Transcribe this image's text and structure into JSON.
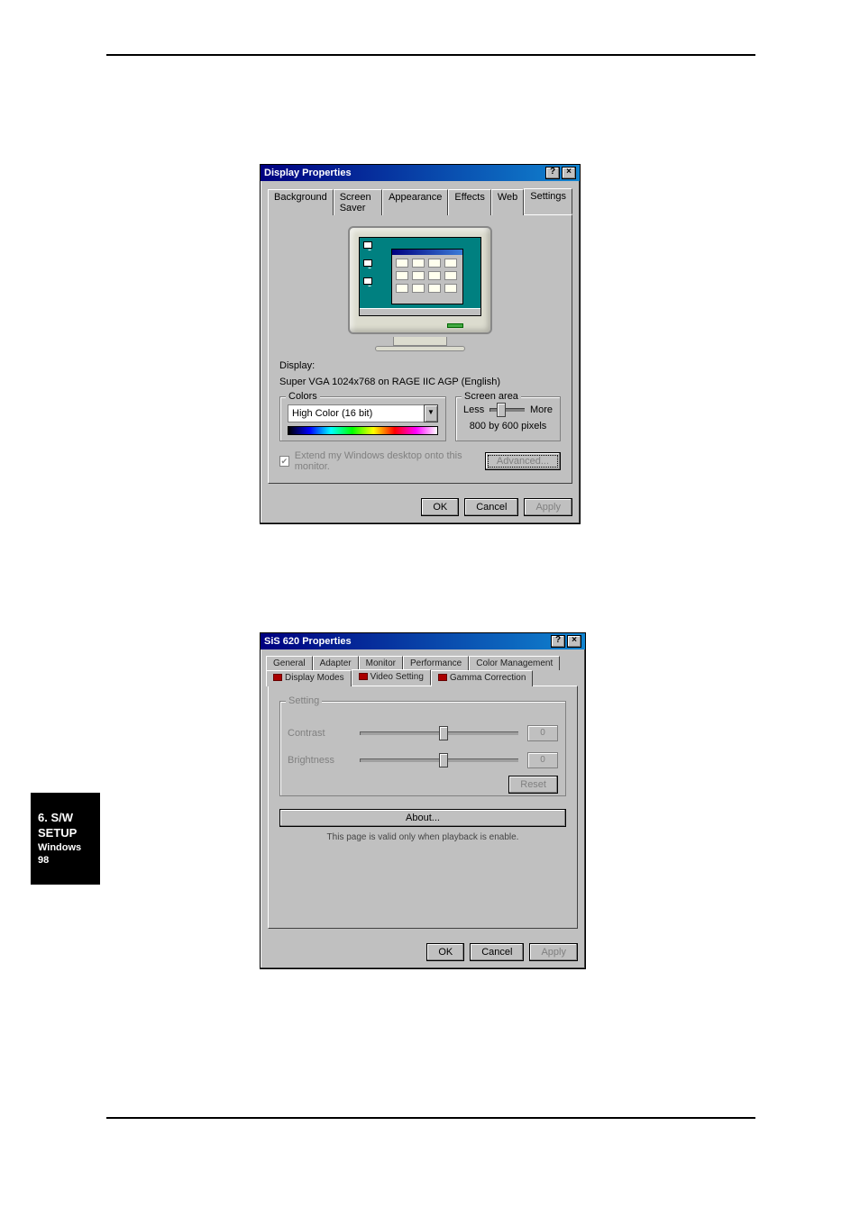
{
  "sidebar": {
    "line1": "6. S/W SETUP",
    "line2": "Windows 98"
  },
  "dlg1": {
    "title": "Display Properties",
    "tabs": [
      "Background",
      "Screen Saver",
      "Appearance",
      "Effects",
      "Web",
      "Settings"
    ],
    "display_label": "Display:",
    "display_value": "Super VGA 1024x768 on RAGE IIC AGP (English)",
    "colors_title": "Colors",
    "colors_value": "High Color (16 bit)",
    "screen_title": "Screen area",
    "less": "Less",
    "more": "More",
    "resolution": "800 by 600 pixels",
    "extend": "Extend my Windows desktop onto this monitor.",
    "advanced": "Advanced...",
    "ok": "OK",
    "cancel": "Cancel",
    "apply": "Apply"
  },
  "dlg2": {
    "title": "SiS 620 Properties",
    "tabs_row1": [
      "General",
      "Adapter",
      "Monitor",
      "Performance",
      "Color Management"
    ],
    "tabs_row2": [
      "Display Modes",
      "Video Setting",
      "Gamma Correction"
    ],
    "setting_title": "Setting",
    "contrast_label": "Contrast",
    "contrast_value": "0",
    "brightness_label": "Brightness",
    "brightness_value": "0",
    "reset": "Reset",
    "about": "About...",
    "note": "This page is valid only when playback is enable.",
    "ok": "OK",
    "cancel": "Cancel",
    "apply": "Apply"
  }
}
